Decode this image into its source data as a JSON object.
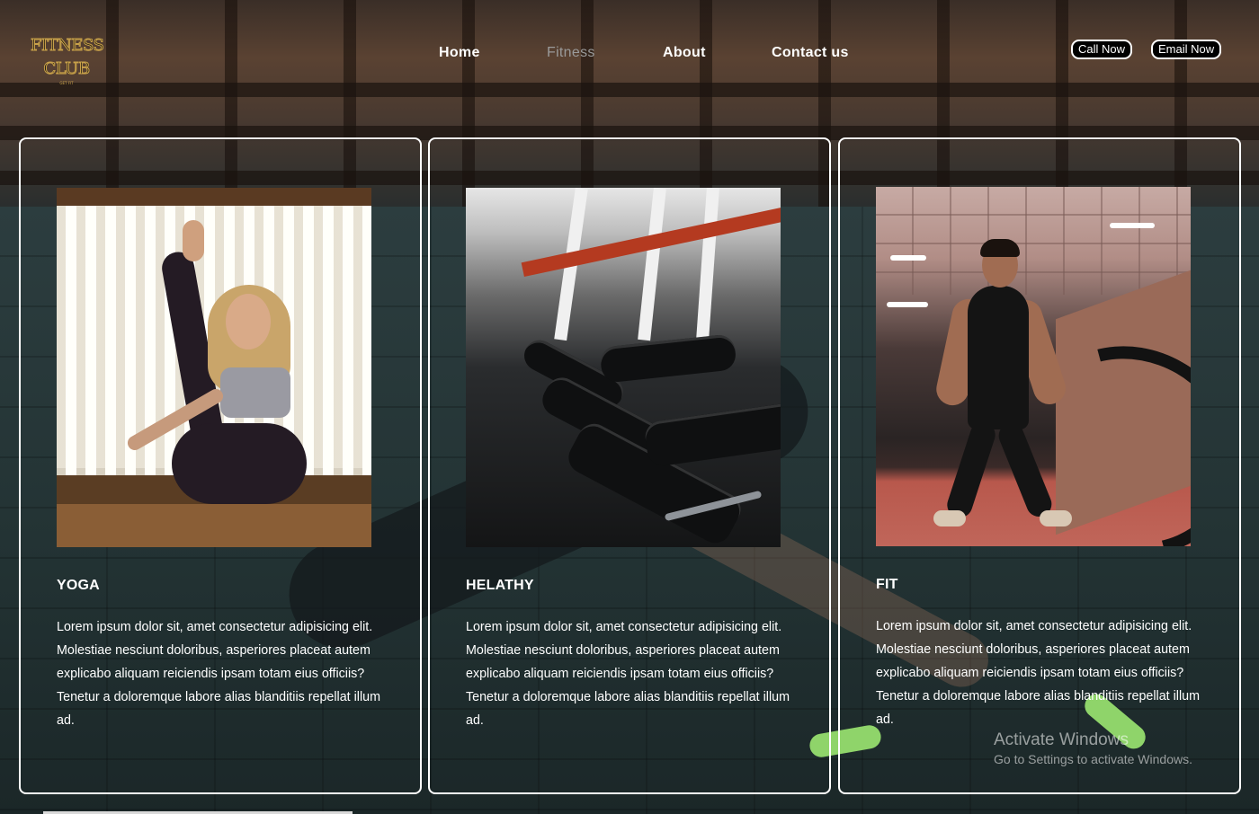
{
  "brand": {
    "line1": "FITNESS",
    "line2": "CLUB",
    "tagline": "GET FIT"
  },
  "nav": {
    "items": [
      "Home",
      "Fitness",
      "About",
      "Contact us"
    ],
    "active": "Fitness"
  },
  "actions": {
    "call_label": "Call Now",
    "email_label": "Email Now"
  },
  "cards": [
    {
      "title": "YOGA",
      "image": "yoga-pose-photo",
      "text": "Lorem ipsum dolor sit, amet consectetur adipisicing elit. Molestiae nesciunt doloribus, asperiores placeat autem explicabo aliquam reiciendis ipsam totam eius officiis? Tenetur a doloremque labore alias blanditiis repellat illum ad."
    },
    {
      "title": "HELATHY",
      "image": "dumbbell-rack-photo",
      "text": "Lorem ipsum dolor sit, amet consectetur adipisicing elit. Molestiae nesciunt doloribus, asperiores placeat autem explicabo aliquam reiciendis ipsam totam eius officiis? Tenetur a doloremque labore alias blanditiis repellat illum ad."
    },
    {
      "title": "FIT",
      "image": "battle-ropes-photo",
      "text": "Lorem ipsum dolor sit, amet consectetur adipisicing elit. Molestiae nesciunt doloribus, asperiores placeat autem explicabo aliquam reiciendis ipsam totam eius officiis? Tenetur a doloremque labore alias blanditiis repellat illum ad."
    }
  ],
  "watermark": {
    "title": "Activate Windows",
    "subtitle": "Go to Settings to activate Windows."
  },
  "colors": {
    "logo_gold": "#c9a24a",
    "nav_active": "#9a9a9a",
    "card_border": "#ffffff",
    "button_bg": "#000000"
  }
}
